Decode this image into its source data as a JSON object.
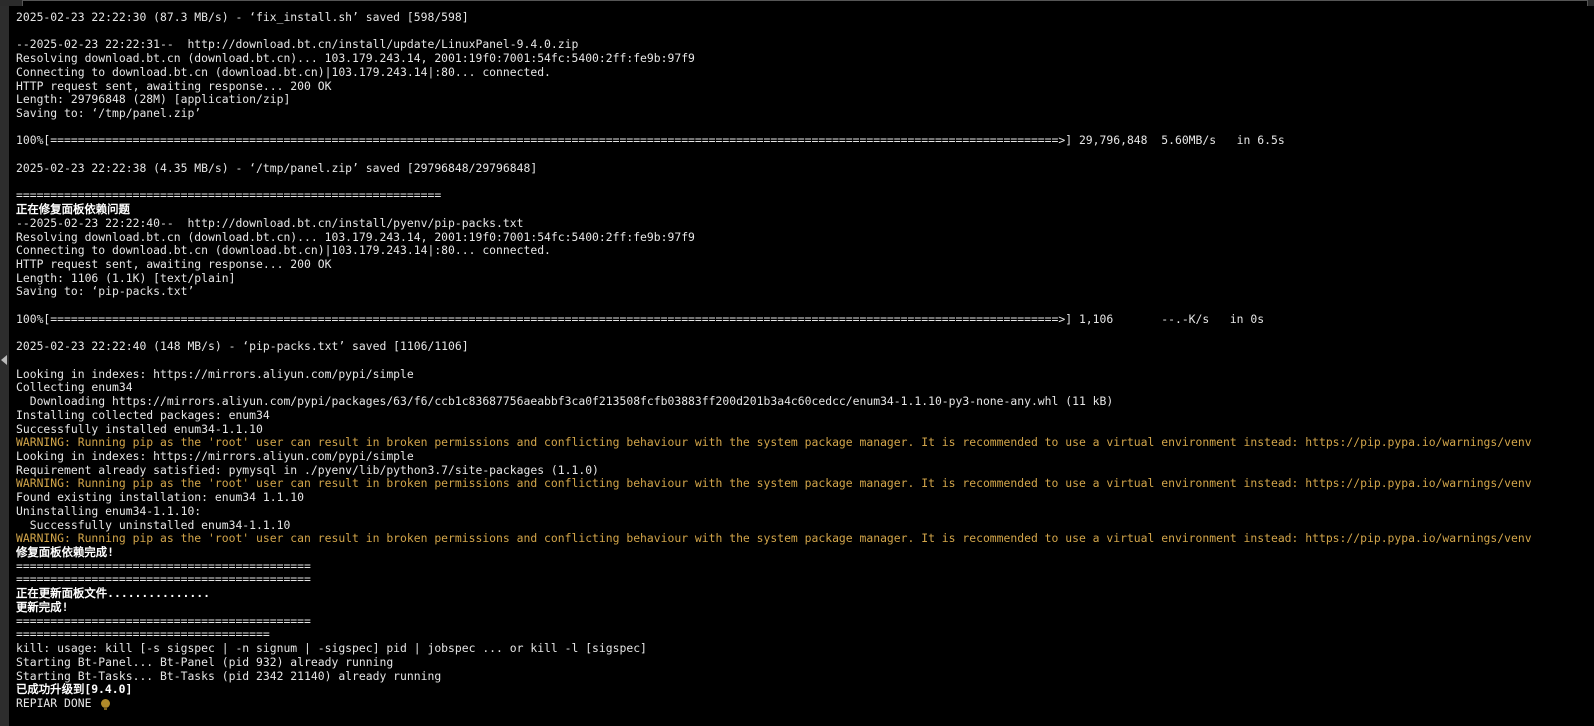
{
  "colors": {
    "background": "#000000",
    "text": "#e6e6e6",
    "warning": "#d2a54a"
  },
  "terminal": {
    "lines": [
      {
        "text": "2025-02-23 22:22:30 (87.3 MB/s) - ‘fix_install.sh’ saved [598/598]",
        "style": "normal"
      },
      {
        "text": "",
        "style": "normal"
      },
      {
        "text": "--2025-02-23 22:22:31--  http://download.bt.cn/install/update/LinuxPanel-9.4.0.zip",
        "style": "normal"
      },
      {
        "text": "Resolving download.bt.cn (download.bt.cn)... 103.179.243.14, 2001:19f0:7001:54fc:5400:2ff:fe9b:97f9",
        "style": "normal"
      },
      {
        "text": "Connecting to download.bt.cn (download.bt.cn)|103.179.243.14|:80... connected.",
        "style": "normal"
      },
      {
        "text": "HTTP request sent, awaiting response... 200 OK",
        "style": "normal"
      },
      {
        "text": "Length: 29796848 (28M) [application/zip]",
        "style": "normal"
      },
      {
        "text": "Saving to: ‘/tmp/panel.zip’",
        "style": "normal"
      },
      {
        "text": "",
        "style": "normal"
      },
      {
        "text": "100%[===================================================================================================================================================>] 29,796,848  5.60MB/s   in 6.5s",
        "style": "normal"
      },
      {
        "text": "",
        "style": "normal"
      },
      {
        "text": "2025-02-23 22:22:38 (4.35 MB/s) - ‘/tmp/panel.zip’ saved [29796848/29796848]",
        "style": "normal"
      },
      {
        "text": "",
        "style": "normal"
      },
      {
        "text": "==============================================================",
        "style": "normal"
      },
      {
        "text": "正在修复面板依赖问题",
        "style": "bold"
      },
      {
        "text": "--2025-02-23 22:22:40--  http://download.bt.cn/install/pyenv/pip-packs.txt",
        "style": "normal"
      },
      {
        "text": "Resolving download.bt.cn (download.bt.cn)... 103.179.243.14, 2001:19f0:7001:54fc:5400:2ff:fe9b:97f9",
        "style": "normal"
      },
      {
        "text": "Connecting to download.bt.cn (download.bt.cn)|103.179.243.14|:80... connected.",
        "style": "normal"
      },
      {
        "text": "HTTP request sent, awaiting response... 200 OK",
        "style": "normal"
      },
      {
        "text": "Length: 1106 (1.1K) [text/plain]",
        "style": "normal"
      },
      {
        "text": "Saving to: ‘pip-packs.txt’",
        "style": "normal"
      },
      {
        "text": "",
        "style": "normal"
      },
      {
        "text": "100%[===================================================================================================================================================>] 1,106       --.-K/s   in 0s",
        "style": "normal"
      },
      {
        "text": "",
        "style": "normal"
      },
      {
        "text": "2025-02-23 22:22:40 (148 MB/s) - ‘pip-packs.txt’ saved [1106/1106]",
        "style": "normal"
      },
      {
        "text": "",
        "style": "normal"
      },
      {
        "text": "Looking in indexes: https://mirrors.aliyun.com/pypi/simple",
        "style": "normal"
      },
      {
        "text": "Collecting enum34",
        "style": "normal"
      },
      {
        "text": "  Downloading https://mirrors.aliyun.com/pypi/packages/63/f6/ccb1c83687756aeabbf3ca0f213508fcfb03883ff200d201b3a4c60cedcc/enum34-1.1.10-py3-none-any.whl (11 kB)",
        "style": "normal"
      },
      {
        "text": "Installing collected packages: enum34",
        "style": "normal"
      },
      {
        "text": "Successfully installed enum34-1.1.10",
        "style": "normal"
      },
      {
        "text": "WARNING: Running pip as the 'root' user can result in broken permissions and conflicting behaviour with the system package manager. It is recommended to use a virtual environment instead: https://pip.pypa.io/warnings/venv",
        "style": "warn"
      },
      {
        "text": "Looking in indexes: https://mirrors.aliyun.com/pypi/simple",
        "style": "normal"
      },
      {
        "text": "Requirement already satisfied: pymysql in ./pyenv/lib/python3.7/site-packages (1.1.0)",
        "style": "normal"
      },
      {
        "text": "WARNING: Running pip as the 'root' user can result in broken permissions and conflicting behaviour with the system package manager. It is recommended to use a virtual environment instead: https://pip.pypa.io/warnings/venv",
        "style": "warn"
      },
      {
        "text": "Found existing installation: enum34 1.1.10",
        "style": "normal"
      },
      {
        "text": "Uninstalling enum34-1.1.10:",
        "style": "normal"
      },
      {
        "text": "  Successfully uninstalled enum34-1.1.10",
        "style": "normal"
      },
      {
        "text": "WARNING: Running pip as the 'root' user can result in broken permissions and conflicting behaviour with the system package manager. It is recommended to use a virtual environment instead: https://pip.pypa.io/warnings/venv",
        "style": "warn"
      },
      {
        "text": "修复面板依赖完成!",
        "style": "bold"
      },
      {
        "text": "===========================================",
        "style": "normal"
      },
      {
        "text": "===========================================",
        "style": "normal"
      },
      {
        "text": "正在更新面板文件...............",
        "style": "bold"
      },
      {
        "text": "更新完成!",
        "style": "bold"
      },
      {
        "text": "===========================================",
        "style": "normal"
      },
      {
        "text": "=====================================",
        "style": "normal"
      },
      {
        "text": "kill: usage: kill [-s sigspec | -n signum | -sigspec] pid | jobspec ... or kill -l [sigspec]",
        "style": "normal"
      },
      {
        "text": "Starting Bt-Panel... Bt-Panel (pid 932) already running",
        "style": "normal"
      },
      {
        "text": "Starting Bt-Tasks... Bt-Tasks (pid 2342 21140) already running",
        "style": "normal"
      },
      {
        "text": "已成功升级到[9.4.0]",
        "style": "bold"
      },
      {
        "text": "REPIAR DONE",
        "style": "normal",
        "cursor_icon": "lightbulb-icon"
      }
    ]
  }
}
